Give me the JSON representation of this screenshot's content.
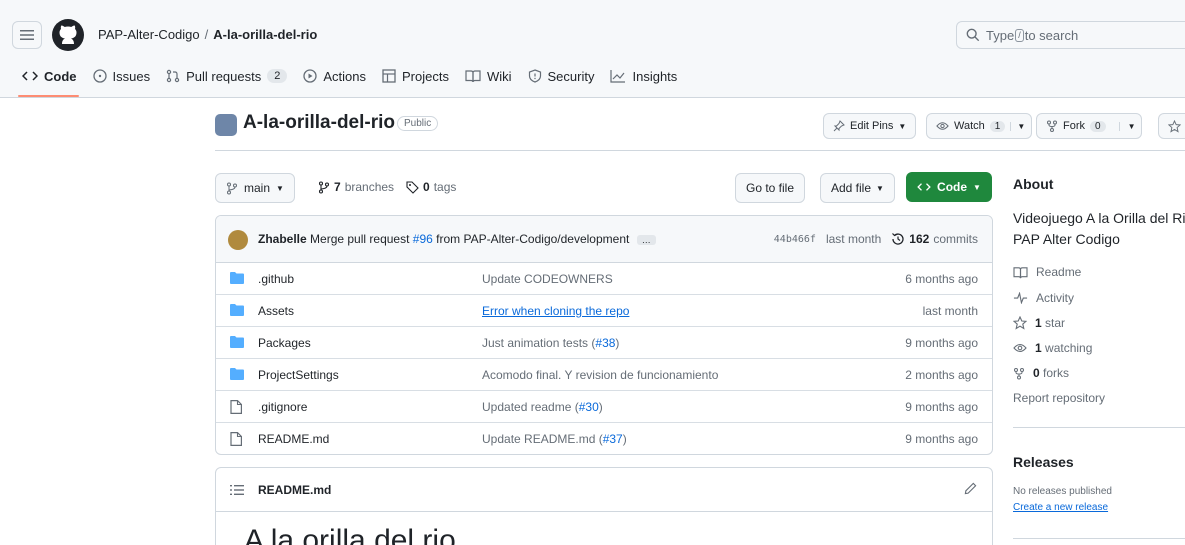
{
  "nav": {
    "owner": "PAP-Alter-Codigo",
    "separator": "/",
    "repo": "A-la-orilla-del-rio",
    "search_prefix": "Type",
    "search_key": "/",
    "search_suffix": "to search"
  },
  "tabs": [
    {
      "label": "Code",
      "icon": "code-icon",
      "active": true
    },
    {
      "label": "Issues",
      "icon": "issue-icon"
    },
    {
      "label": "Pull requests",
      "icon": "pull-request-icon",
      "count": "2"
    },
    {
      "label": "Actions",
      "icon": "play-icon"
    },
    {
      "label": "Projects",
      "icon": "table-icon"
    },
    {
      "label": "Wiki",
      "icon": "book-icon"
    },
    {
      "label": "Security",
      "icon": "shield-icon"
    },
    {
      "label": "Insights",
      "icon": "graph-icon"
    }
  ],
  "repo_header": {
    "title": "A-la-orilla-del-rio",
    "visibility": "Public",
    "edit_pins": "Edit Pins",
    "watch": "Watch",
    "watch_count": "1",
    "fork": "Fork",
    "fork_count": "0"
  },
  "toolbar": {
    "branch": "main",
    "branches_count": "7",
    "branches_label": "branches",
    "tags_count": "0",
    "tags_label": "tags",
    "go_to_file": "Go to file",
    "add_file": "Add file",
    "code": "Code"
  },
  "latest_commit": {
    "author": "Zhabelle",
    "message_prefix": "Merge pull request",
    "pr": "#96",
    "message_suffix": "from PAP-Alter-Codigo/development",
    "ellipsis": "…",
    "sha": "44b466f",
    "when": "last month",
    "commits_count": "162",
    "commits_label": "commits"
  },
  "files": [
    {
      "name": ".github",
      "type": "folder",
      "msg": "Update CODEOWNERS",
      "link": "",
      "age": "6 months ago"
    },
    {
      "name": "Assets",
      "type": "folder",
      "msg": "",
      "link_underlined": "Error when cloning the repo",
      "age": "last month"
    },
    {
      "name": "Packages",
      "type": "folder",
      "msg": "Just animation tests (",
      "link": "#38",
      "close": ")",
      "age": "9 months ago"
    },
    {
      "name": "ProjectSettings",
      "type": "folder",
      "msg": "Acomodo final. Y revision de funcionamiento",
      "link": "",
      "age": "2 months ago"
    },
    {
      "name": ".gitignore",
      "type": "file",
      "msg": "Updated readme (",
      "link": "#30",
      "close": ")",
      "age": "9 months ago"
    },
    {
      "name": "README.md",
      "type": "file",
      "msg": "Update README.md (",
      "link": "#37",
      "close": ")",
      "age": "9 months ago"
    }
  ],
  "readme": {
    "filename": "README.md",
    "heading": "A la orilla del rio"
  },
  "about": {
    "heading": "About",
    "description_line1": "Videojuego A la Orilla del Ri",
    "description_line2": "PAP Alter Codigo",
    "readme": "Readme",
    "activity": "Activity",
    "stars_count": "1",
    "stars_label": "star",
    "watching_count": "1",
    "watching_label": "watching",
    "forks_count": "0",
    "forks_label": "forks",
    "report": "Report repository"
  },
  "releases": {
    "heading": "Releases",
    "none": "No releases published",
    "create": "Create a new release"
  },
  "colors": {
    "accent_green": "#1f883d",
    "link_blue": "#0969da",
    "folder_blue": "#54aeff",
    "tab_underline": "#fd8c73"
  }
}
